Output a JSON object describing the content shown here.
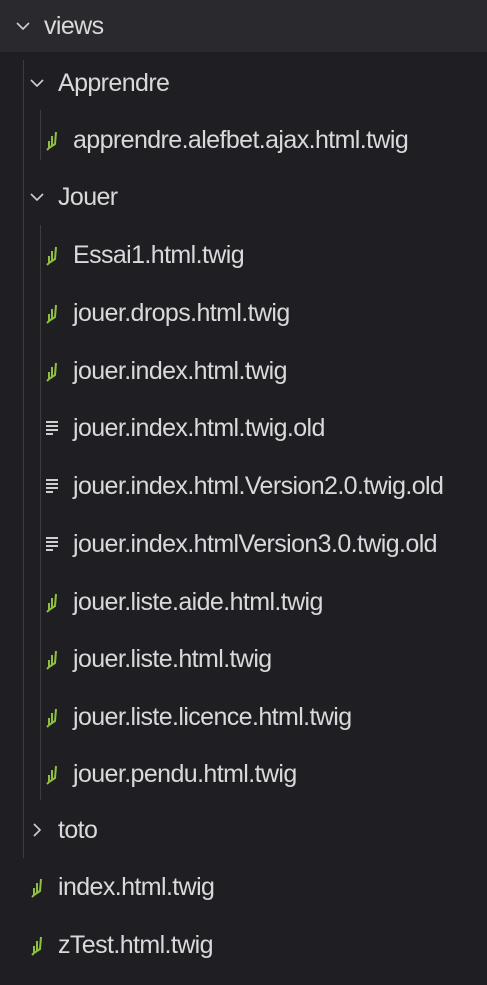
{
  "explorer": {
    "root": {
      "label": "views",
      "state": "expanded"
    },
    "items": [
      {
        "id": "apprendre",
        "type": "folder",
        "label": "Apprendre",
        "state": "expanded",
        "depth": 1
      },
      {
        "id": "f1",
        "type": "twig",
        "label": "apprendre.alefbet.ajax.html.twig",
        "depth": 2
      },
      {
        "id": "jouer",
        "type": "folder",
        "label": "Jouer",
        "state": "expanded",
        "depth": 1
      },
      {
        "id": "f2",
        "type": "twig",
        "label": "Essai1.html.twig",
        "depth": 2
      },
      {
        "id": "f3",
        "type": "twig",
        "label": "jouer.drops.html.twig",
        "depth": 2
      },
      {
        "id": "f4",
        "type": "twig",
        "label": "jouer.index.html.twig",
        "depth": 2
      },
      {
        "id": "f5",
        "type": "text",
        "label": "jouer.index.html.twig.old",
        "depth": 2
      },
      {
        "id": "f6",
        "type": "text",
        "label": "jouer.index.html.Version2.0.twig.old",
        "depth": 2
      },
      {
        "id": "f7",
        "type": "text",
        "label": "jouer.index.htmlVersion3.0.twig.old",
        "depth": 2
      },
      {
        "id": "f8",
        "type": "twig",
        "label": "jouer.liste.aide.html.twig",
        "depth": 2
      },
      {
        "id": "f9",
        "type": "twig",
        "label": "jouer.liste.html.twig",
        "depth": 2
      },
      {
        "id": "f10",
        "type": "twig",
        "label": "jouer.liste.licence.html.twig",
        "depth": 2
      },
      {
        "id": "f11",
        "type": "twig",
        "label": "jouer.pendu.html.twig",
        "depth": 2
      },
      {
        "id": "toto",
        "type": "folder",
        "label": "toto",
        "state": "collapsed",
        "depth": 1
      },
      {
        "id": "f12",
        "type": "twig",
        "label": "index.html.twig",
        "depth": 1
      },
      {
        "id": "f13",
        "type": "twig",
        "label": "zTest.html.twig",
        "depth": 1
      }
    ]
  },
  "icons": {
    "expanded": "chevron-down-icon",
    "collapsed": "chevron-right-icon",
    "twig": "twig-file-icon",
    "text": "text-file-icon"
  },
  "colors": {
    "background": "#1f1f23",
    "header_background": "#2a2a2e",
    "text": "#d9d9d9",
    "twig_icon": "#8fbf3f",
    "text_icon": "#cfcfcf",
    "guide": "#3b3b40"
  }
}
